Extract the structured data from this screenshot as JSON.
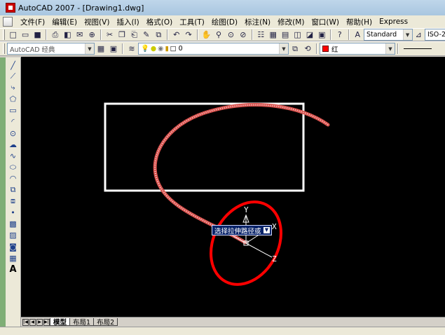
{
  "window": {
    "title": "AutoCAD 2007 - [Drawing1.dwg]"
  },
  "menu": {
    "items": [
      "文件(F)",
      "编辑(E)",
      "视图(V)",
      "插入(I)",
      "格式(O)",
      "工具(T)",
      "绘图(D)",
      "标注(N)",
      "修改(M)",
      "窗口(W)",
      "帮助(H)",
      "Express"
    ]
  },
  "toolbar1": {
    "text_style": "Standard",
    "dim_style": "ISO-2"
  },
  "toolbar2": {
    "workspace": "AutoCAD 经典",
    "layer": "0",
    "color": "红",
    "color_hex": "#ff0000"
  },
  "canvas": {
    "background": "#000000",
    "tooltip": "选择拉伸路径或",
    "axis_y": "Y",
    "axis_x": "X",
    "axis_z": "Z",
    "rectangle_color": "#ffffff",
    "spline_color": "#d9534f",
    "ellipse_color": "#ff0000"
  },
  "layout_tabs": [
    "模型",
    "布局1",
    "布局2"
  ]
}
